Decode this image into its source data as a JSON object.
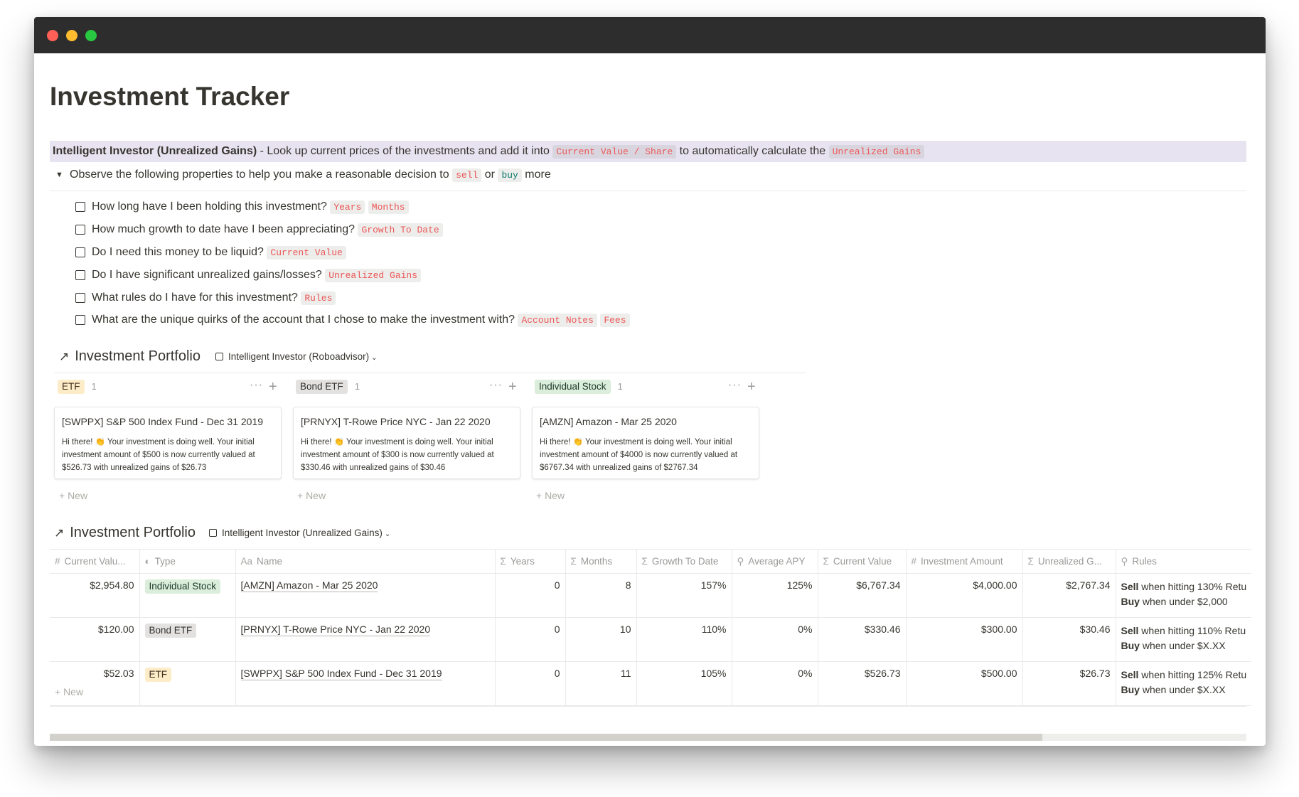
{
  "window": {
    "controls": [
      "close",
      "minimize",
      "maximize"
    ]
  },
  "page": {
    "title": "Investment Tracker",
    "callout": {
      "bold": "Intelligent Investor (Unrealized Gains)",
      "text1": " - Look up current prices of the investments and add it into ",
      "code1": "Current Value / Share",
      "text2": " to automatically calculate the ",
      "code2": "Unrealized Gains"
    },
    "toggle": {
      "text1": "Observe the following properties to help you make a reasonable decision to ",
      "code_sell": "sell",
      "text_or": " or ",
      "code_buy": "buy",
      "text2": " more"
    },
    "todos": [
      {
        "text": "How long have I been holding this investment?",
        "codes": [
          "Years",
          "Months"
        ]
      },
      {
        "text": "How much growth to date have I been appreciating?",
        "codes": [
          "Growth To Date"
        ]
      },
      {
        "text": "Do I need this money to be liquid?",
        "codes": [
          "Current Value"
        ]
      },
      {
        "text": "Do I have significant unrealized gains/losses?",
        "codes": [
          "Unrealized Gains"
        ]
      },
      {
        "text": "What rules do I have for this investment?",
        "codes": [
          "Rules"
        ]
      },
      {
        "text": "What are the unique quirks of the account that I chose to make the investment with?",
        "codes": [
          "Account Notes",
          "Fees"
        ]
      }
    ]
  },
  "board": {
    "title": "Investment Portfolio",
    "view": "Intelligent Investor (Roboadvisor)",
    "columns": [
      {
        "tag": "ETF",
        "count": "1",
        "actions": "···",
        "add": "+",
        "card_title": "[SWPPX] S&P 500 Index Fund - Dec 31 2019",
        "card_text": "Hi there! 👏 Your investment is doing well. Your initial investment amount of $500 is now currently valued at $526.73 with unrealized gains of $26.73",
        "new": "+ New"
      },
      {
        "tag": "Bond ETF",
        "count": "1",
        "actions": "···",
        "add": "+",
        "card_title": "[PRNYX] T-Rowe Price NYC - Jan 22 2020",
        "card_text": "Hi there! 👏 Your investment is doing well. Your initial investment amount of $300 is now currently valued at $330.46 with unrealized gains of $30.46",
        "new": "+ New"
      },
      {
        "tag": "Individual Stock",
        "count": "1",
        "actions": "···",
        "add": "+",
        "card_title": "[AMZN] Amazon - Mar 25 2020",
        "card_text": "Hi there! 👏 Your investment is doing well. Your initial investment amount of $4000 is now currently valued at $6767.34 with unrealized gains of $2767.34",
        "new": "+ New"
      }
    ]
  },
  "table": {
    "title": "Investment Portfolio",
    "view": "Intelligent Investor (Unrealized Gains)",
    "headers": [
      {
        "icon": "#",
        "label": "Current Valu..."
      },
      {
        "icon": "◐",
        "label": "Type"
      },
      {
        "icon": "Aa",
        "label": "Name"
      },
      {
        "icon": "Σ",
        "label": "Years"
      },
      {
        "icon": "Σ",
        "label": "Months"
      },
      {
        "icon": "Σ",
        "label": "Growth To Date"
      },
      {
        "icon": "⚲",
        "label": "Average APY"
      },
      {
        "icon": "Σ",
        "label": "Current Value"
      },
      {
        "icon": "#",
        "label": "Investment Amount"
      },
      {
        "icon": "Σ",
        "label": "Unrealized G..."
      },
      {
        "icon": "⚲",
        "label": "Rules"
      }
    ],
    "rows": [
      {
        "current_value_share": "$2,954.80",
        "type": "Individual Stock",
        "name": "[AMZN] Amazon - Mar 25 2020",
        "years": "0",
        "months": "8",
        "growth": "157%",
        "apy": "125%",
        "current_value": "$6,767.34",
        "investment": "$4,000.00",
        "unrealized": "$2,767.34",
        "rule_sell_bold": "Sell",
        "rule_sell": " when hitting 130% Retu",
        "rule_buy_bold": "Buy",
        "rule_buy": " when under $2,000"
      },
      {
        "current_value_share": "$120.00",
        "type": "Bond ETF",
        "name": "[PRNYX] T-Rowe Price NYC - Jan 22 2020",
        "years": "0",
        "months": "10",
        "growth": "110%",
        "apy": "0%",
        "current_value": "$330.46",
        "investment": "$300.00",
        "unrealized": "$30.46",
        "rule_sell_bold": "Sell",
        "rule_sell": " when hitting 110% Retu",
        "rule_buy_bold": "Buy",
        "rule_buy": " when under $X.XX"
      },
      {
        "current_value_share": "$52.03",
        "type": "ETF",
        "name": "[SWPPX] S&P 500 Index Fund - Dec 31 2019",
        "years": "0",
        "months": "11",
        "growth": "105%",
        "apy": "0%",
        "current_value": "$526.73",
        "investment": "$500.00",
        "unrealized": "$26.73",
        "rule_sell_bold": "Sell",
        "rule_sell": " when hitting 125% Retu",
        "rule_buy_bold": "Buy",
        "rule_buy": " when under $X.XX"
      }
    ],
    "new": "+ New"
  },
  "colors": {
    "callout_bg": "#e8e3f1",
    "code_text": "#eb5757",
    "tag_etf": "#fdecc8",
    "tag_bond": "#e3e2e0",
    "tag_stock": "#dbeddb"
  }
}
